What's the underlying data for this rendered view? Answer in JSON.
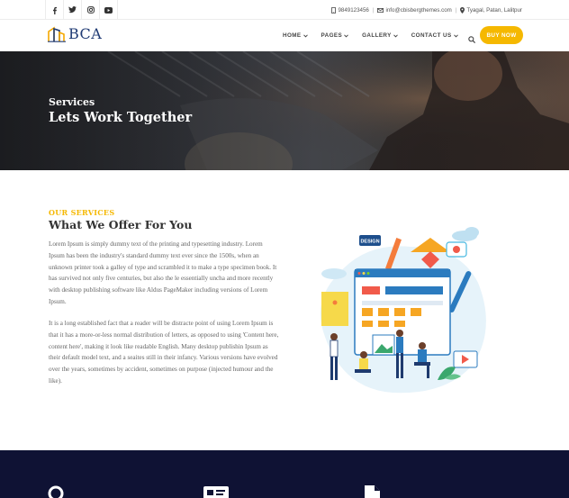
{
  "topbar": {
    "social_icons": [
      "facebook-icon",
      "twitter-icon",
      "instagram-icon",
      "youtube-icon"
    ],
    "phone": "9849123456",
    "email": "info@cbisbergthemes.com",
    "address": "Tyagal, Patan, Lalitpur",
    "separator": "|"
  },
  "header": {
    "logo_text": "BCA",
    "nav": [
      "HOME",
      "PAGES",
      "GALLERY",
      "CONTACT US"
    ],
    "buy_label": "BUY NOW"
  },
  "hero": {
    "subtitle": "Services",
    "title": "Lets Work Together"
  },
  "services": {
    "kicker": "OUR SERVICES",
    "title": "What We Offer For You",
    "paragraph1": "Lorem Ipsum is simply dummy text of the printing and typesetting industry. Lorem Ipsum has been the industry's standard dummy text ever since the 1500s, when an unknown printer took a galley of type and scrambled it to make a type specimen book. It has survived not only five centuries, but also the le essentially uncha and more recently with desktop publishing software like Aldus PageMaker including versions of Lorem Ipsum.",
    "paragraph2": "It is a long established fact that a reader will be distracte point of using Lorem Ipsum is that it has a more-or-less normal distribution of letters, as opposed to using 'Content here, content here', making it look like readable English. Many desktop publishin Ipsum as their default model text, and a seaites still in their infancy. Various versions have evolved over the years, sometimes by accident, sometimes on purpose (injected humour and the like).",
    "illustration_badge": "DESIGN"
  },
  "colors": {
    "accent": "#f5b800",
    "brand_navy": "#203b74",
    "dark_band": "#0f1234"
  }
}
